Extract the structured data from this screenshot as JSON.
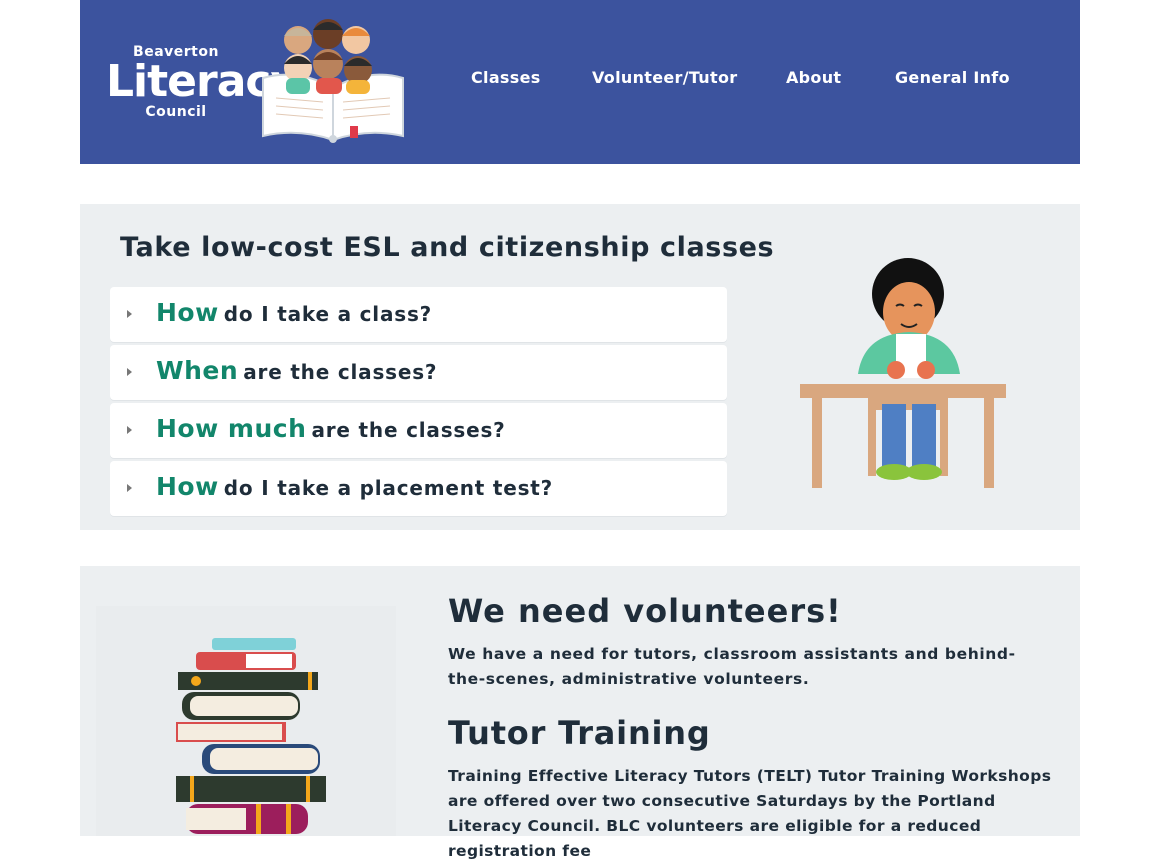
{
  "header": {
    "logo": {
      "top": "Beaverton",
      "main": "Literacy",
      "bottom": "Council"
    },
    "nav": [
      "Classes",
      "Volunteer/Tutor",
      "About",
      "General Info"
    ]
  },
  "classes_section": {
    "title": "Take low-cost ESL and citizenship classes",
    "faq": [
      {
        "emphasis": "How",
        "rest": "do I take a class?"
      },
      {
        "emphasis": "When",
        "rest": "are the classes?"
      },
      {
        "emphasis": "How much",
        "rest": "are the classes?"
      },
      {
        "emphasis": "How",
        "rest": "do I take a placement test?"
      }
    ]
  },
  "volunteer_section": {
    "heading": "We need volunteers!",
    "intro": "We have a need for tutors, classroom assistants and behind-the-scenes, administrative volunteers.",
    "training_heading": "Tutor Training",
    "training_text": "Training Effective Literacy Tutors (TELT) Tutor Training Workshops are offered over two consecutive Saturdays by the Portland Literacy Council. BLC volunteers are eligible for a reduced registration fee"
  },
  "colors": {
    "header_bg": "#3c539e",
    "accent_green": "#12866b",
    "panel_bg": "#eceff1"
  }
}
